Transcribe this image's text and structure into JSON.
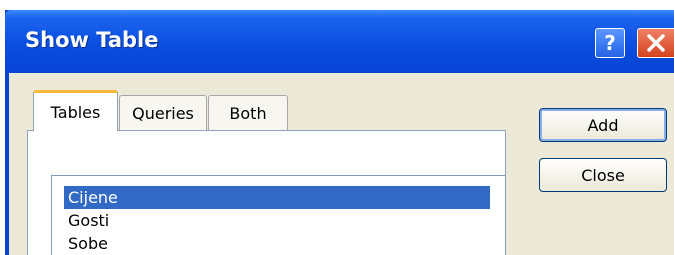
{
  "window": {
    "title": "Show Table",
    "help_label": "?",
    "close_icon": "close-icon"
  },
  "tabs": [
    {
      "label": "Tables",
      "selected": true
    },
    {
      "label": "Queries",
      "selected": false
    },
    {
      "label": "Both",
      "selected": false
    }
  ],
  "list": {
    "items": [
      {
        "label": "Cijene",
        "selected": true
      },
      {
        "label": "Gosti",
        "selected": false
      },
      {
        "label": "Sobe",
        "selected": false
      }
    ]
  },
  "buttons": {
    "add_label": "Add",
    "close_label": "Close"
  },
  "colors": {
    "titlebar": "#0a4ee0",
    "selection": "#316ac5",
    "active_tab_accent": "#f9b838",
    "dialog_face": "#ece9d8"
  }
}
